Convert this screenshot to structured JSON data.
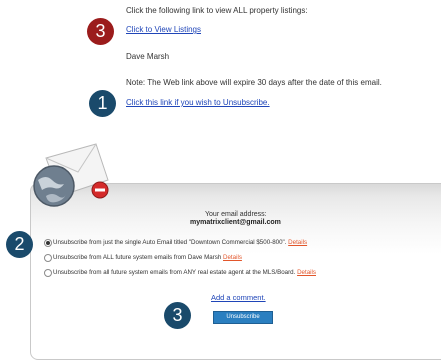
{
  "email": {
    "intro": "Click the following link to view ALL property listings:",
    "view_link": "Click to View Listings",
    "signature": "Dave Marsh",
    "note": "Note: The Web link above will expire 30 days after the date of this email.",
    "unsub_link": "Click this link if you wish to Unsubscribe."
  },
  "callouts": [
    "3",
    "1",
    "2",
    "3"
  ],
  "colors": {
    "callout_red": "#9b1c1c",
    "callout_navy": "#1a4a6b",
    "link": "#1f45b8",
    "details": "#e2562b",
    "button": "#2b7fc0"
  },
  "panel": {
    "address_label": "Your email address:",
    "address": "mymatrixclient@gmail.com",
    "options": [
      {
        "text": "Unsubscribe from just the single Auto Email titled \"Downtown Commercial $500-800\".",
        "details": "Details",
        "selected": true
      },
      {
        "text": "Unsubscribe from ALL future system emails from Dave Marsh",
        "details": "Details",
        "selected": false
      },
      {
        "text": "Unsubscribe from all future system emails from ANY real estate agent at the MLS/Board.",
        "details": "Details",
        "selected": false
      }
    ],
    "comment_link": "Add a comment.",
    "button": "Unsubscribe"
  }
}
